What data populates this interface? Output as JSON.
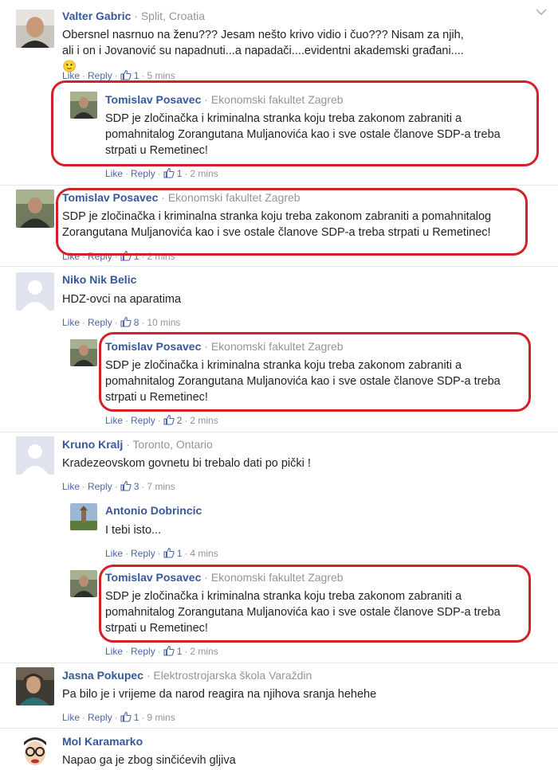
{
  "actions": {
    "like": "Like",
    "reply": "Reply",
    "sep": "·"
  },
  "colors": {
    "highlight": "#d32029",
    "link": "#365899",
    "meta": "#90949c"
  },
  "comments": [
    {
      "name": "Valter Gabric",
      "meta": "· Split, Croatia",
      "text": "Obersnel nasrnuo na ženu??? Jesam nešto krivo vidio i čuo??? Nisam za njih, ali i on i Jovanović su napadnuti...a napadači....evidentni akademski građani....🙂",
      "likes": "1",
      "time": "5 mins"
    },
    {
      "name": "Tomislav Posavec",
      "meta": "· Ekonomski fakultet Zagreb",
      "text": "SDP je zločinačka i kriminalna stranka koju treba zakonom zabraniti a pomahnitalog Zorangutana Muljanovića kao i sve ostale članove SDP-a treba strpati u Remetinec!",
      "likes": "1",
      "time": "2 mins"
    },
    {
      "name": "Tomislav Posavec",
      "meta": "· Ekonomski fakultet Zagreb",
      "text": "SDP je zločinačka i kriminalna stranka koju treba zakonom zabraniti a pomahnitalog Zorangutana Muljanovića kao i sve ostale članove SDP-a treba strpati u Remetinec!",
      "likes": "1",
      "time": "2 mins"
    },
    {
      "name": "Niko Nik Belic",
      "meta": "",
      "text": "HDZ-ovci na aparatima",
      "likes": "8",
      "time": "10 mins"
    },
    {
      "name": "Tomislav Posavec",
      "meta": "· Ekonomski fakultet Zagreb",
      "text": "SDP je zločinačka i kriminalna stranka koju treba zakonom zabraniti a pomahnitalog Zorangutana Muljanovića kao i sve ostale članove SDP-a treba strpati u Remetinec!",
      "likes": "2",
      "time": "2 mins"
    },
    {
      "name": "Kruno Kralj",
      "meta": "· Toronto, Ontario",
      "text": "Kradezeovskom govnetu bi trebalo dati po pički !",
      "likes": "3",
      "time": "7 mins"
    },
    {
      "name": "Antonio Dobrincic",
      "meta": "",
      "text": "I tebi isto...",
      "likes": "1",
      "time": "4 mins"
    },
    {
      "name": "Tomislav Posavec",
      "meta": "· Ekonomski fakultet Zagreb",
      "text": "SDP je zločinačka i kriminalna stranka koju treba zakonom zabraniti a pomahnitalog Zorangutana Muljanovića kao i sve ostale članove SDP-a treba strpati u Remetinec!",
      "likes": "1",
      "time": "2 mins"
    },
    {
      "name": "Jasna Pokupec",
      "meta": "· Elektrostrojarska škola Varaždin",
      "text": "Pa bilo je i vrijeme da narod reagira na njihova sranja hehehe",
      "likes": "1",
      "time": "9 mins"
    },
    {
      "name": "Mol Karamarko",
      "meta": "",
      "text": "Napao ga je zbog sinčićevih gljiva",
      "likes": "",
      "time": ""
    }
  ]
}
